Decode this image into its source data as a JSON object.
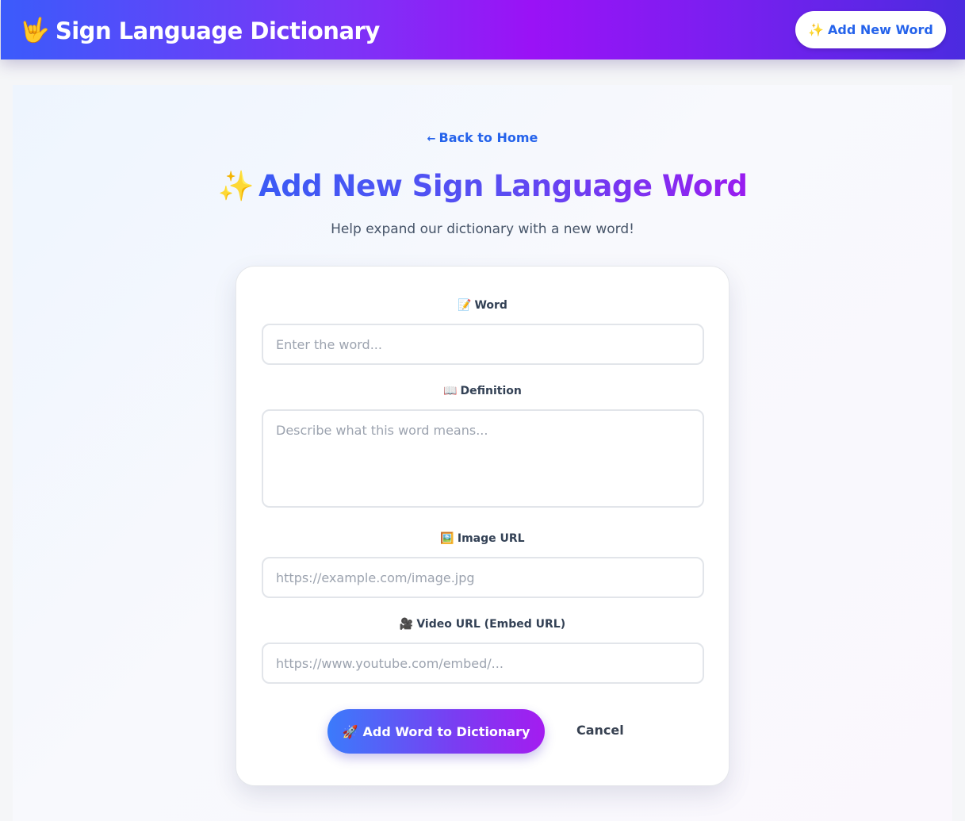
{
  "navbar": {
    "brand_icon": "🤟",
    "brand_title": "Sign Language Dictionary",
    "add_button_icon": "✨",
    "add_button_label": "Add New Word"
  },
  "page": {
    "back_arrow": "←",
    "back_label": "Back to Home",
    "title_icon": "✨",
    "title": "Add New Sign Language Word",
    "subtitle": "Help expand our dictionary with a new word!"
  },
  "form": {
    "word": {
      "icon": "📝",
      "label": "Word",
      "placeholder": "Enter the word...",
      "value": ""
    },
    "definition": {
      "icon": "📖",
      "label": "Definition",
      "placeholder": "Describe what this word means...",
      "value": ""
    },
    "image_url": {
      "icon": "🖼️",
      "label": "Image URL",
      "placeholder": "https://example.com/image.jpg",
      "value": ""
    },
    "video_url": {
      "icon": "🎥",
      "label": "Video URL (Embed URL)",
      "placeholder": "https://www.youtube.com/embed/...",
      "value": ""
    },
    "submit_icon": "🚀",
    "submit_label": "Add Word to Dictionary",
    "cancel_label": "Cancel"
  },
  "colors": {
    "accent_blue": "#2563eb",
    "gradient_start": "#3b5bfb",
    "gradient_end": "#9a12f6"
  }
}
